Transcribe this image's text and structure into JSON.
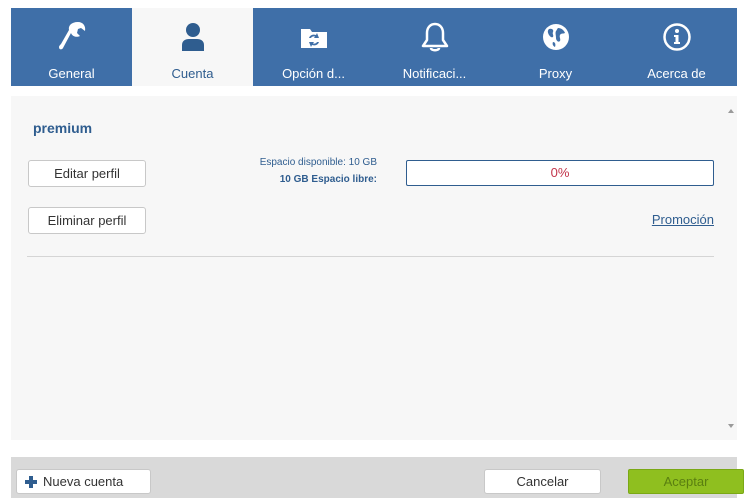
{
  "tabs": [
    {
      "label": "General",
      "icon": "wrench-icon",
      "active": false
    },
    {
      "label": "Cuenta",
      "icon": "user-icon",
      "active": true
    },
    {
      "label": "Opción d...",
      "icon": "sync-folder-icon",
      "active": false
    },
    {
      "label": "Notificaci...",
      "icon": "bell-icon",
      "active": false
    },
    {
      "label": "Proxy",
      "icon": "globe-icon",
      "active": false
    },
    {
      "label": "Acerca de",
      "icon": "info-icon",
      "active": false
    }
  ],
  "account": {
    "name": "premium",
    "edit_label": "Editar perfil",
    "delete_label": "Eliminar perfil",
    "space_available": "Espacio disponible: 10 GB",
    "space_free": "10 GB Espacio libre:",
    "usage_percent": 0,
    "usage_text": "0%",
    "promo_label": "Promoción"
  },
  "footer": {
    "new_account_label": "Nueva cuenta",
    "cancel_label": "Cancelar",
    "accept_label": "Aceptar"
  },
  "colors": {
    "tab_bar": "#3f6fa8",
    "accent_text": "#2f5d8f",
    "accept_button": "#8fbf1f",
    "progress_text": "#c2344a"
  }
}
